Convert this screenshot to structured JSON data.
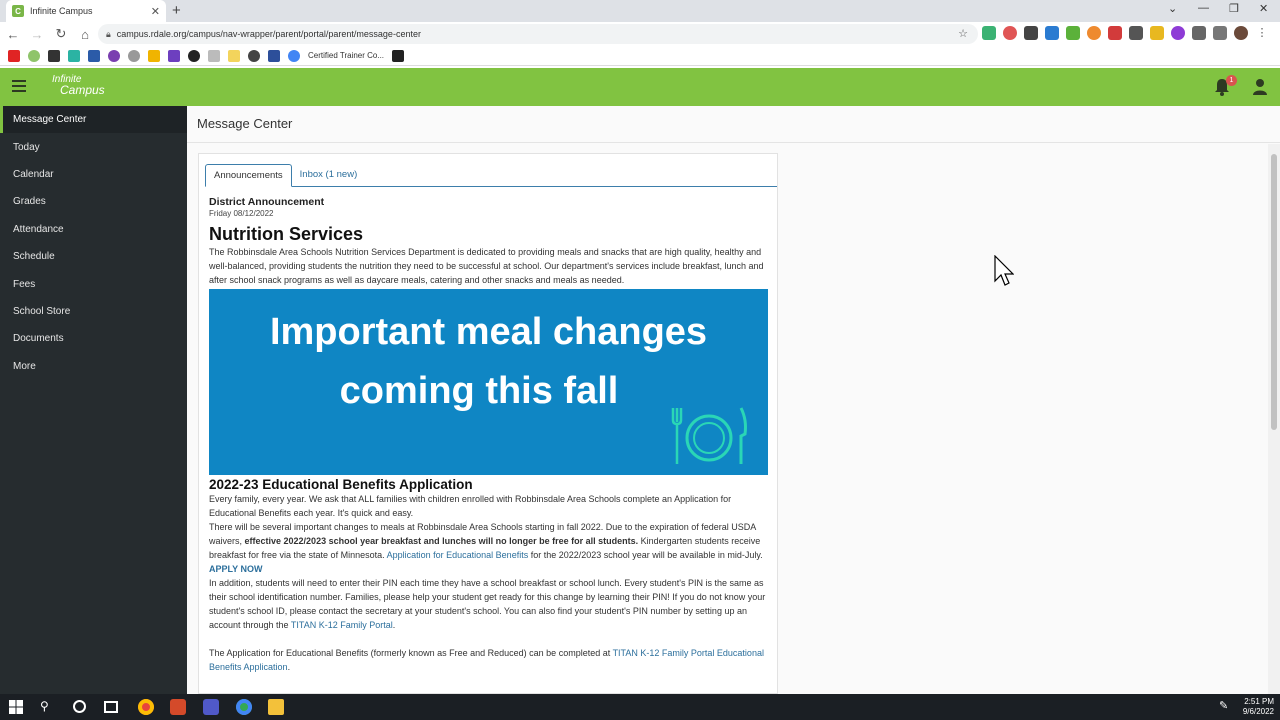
{
  "browser": {
    "tab_title": "Infinite Campus",
    "tab_favicon": "C",
    "tab_close": "✕",
    "new_tab": "+",
    "url": "campus.rdale.org/campus/nav-wrapper/parent/portal/parent/message-center",
    "bookmark_label": "Certified Trainer Co...",
    "win_min": "—",
    "win_max": "❐",
    "win_close": "✕",
    "win_list": "⌄"
  },
  "app": {
    "logo_line1": "Infinite",
    "logo_line2": "Campus",
    "notification_count": "1"
  },
  "sidebar": {
    "items": [
      {
        "label": "Message Center"
      },
      {
        "label": "Today"
      },
      {
        "label": "Calendar"
      },
      {
        "label": "Grades"
      },
      {
        "label": "Attendance"
      },
      {
        "label": "Schedule"
      },
      {
        "label": "Fees"
      },
      {
        "label": "School Store"
      },
      {
        "label": "Documents"
      },
      {
        "label": "More"
      }
    ]
  },
  "main": {
    "page_title": "Message Center",
    "tabs": [
      {
        "label": "Announcements"
      },
      {
        "label": "Inbox (1 new)"
      }
    ],
    "announcement": {
      "title": "District Announcement",
      "date": "Friday 08/12/2022",
      "heading": "Nutrition Services",
      "intro": "The Robbinsdale Area Schools Nutrition Services Department is dedicated to providing meals and snacks that are high quality, healthy and well-balanced, providing students the nutrition they need to be successful at school. Our department's services include breakfast, lunch and after school snack programs as well as daycare meals, catering and other snacks and meals as needed.",
      "banner_line1": "Important meal changes",
      "banner_line2": "coming this fall",
      "section_heading": "2022-23 Educational Benefits Application",
      "para1": "Every family, every year. We ask that ALL families with children enrolled with Robbinsdale Area Schools complete an Application for Educational Benefits each year. It's quick and easy.",
      "para2_a": "There will be several important changes to meals at Robbinsdale Area Schools starting in fall 2022. Due to the expiration of federal USDA waivers, ",
      "para2_bold": "effective 2022/2023 school year breakfast and lunches will no longer be free for all students.",
      "para2_b": " Kindergarten students receive breakfast for free via the state of Minnesota. ",
      "para2_link": "Application for Educational Benefits",
      "para2_c": " for the 2022/2023 school year will be available in mid-July.",
      "apply_now": "APPLY NOW",
      "para3_a": "In addition, students will need to enter their PIN each time they have a school breakfast or school lunch. Every student's PIN is the same as their school identification number. Families, please help your student get ready for this change by learning their PIN! If you do not know your student's school ID, please  contact the secretary at your student's school. You can also find your student's PIN number by setting up an account through the ",
      "para3_link": "TITAN K-12 Family Portal",
      "para3_b": ".",
      "para4_a": "The Application for Educational Benefits (formerly known as Free and Reduced) can be completed at ",
      "para4_link": "TITAN K-12 Family Portal Educational Benefits Application",
      "para4_b": "."
    }
  },
  "taskbar": {
    "time": "2:51 PM",
    "date": "9/6/2022"
  },
  "colors": {
    "brand_green": "#81c341",
    "sidebar_bg": "#262c2f",
    "link_blue": "#2c6f9c",
    "banner_blue": "#0f86c4"
  }
}
